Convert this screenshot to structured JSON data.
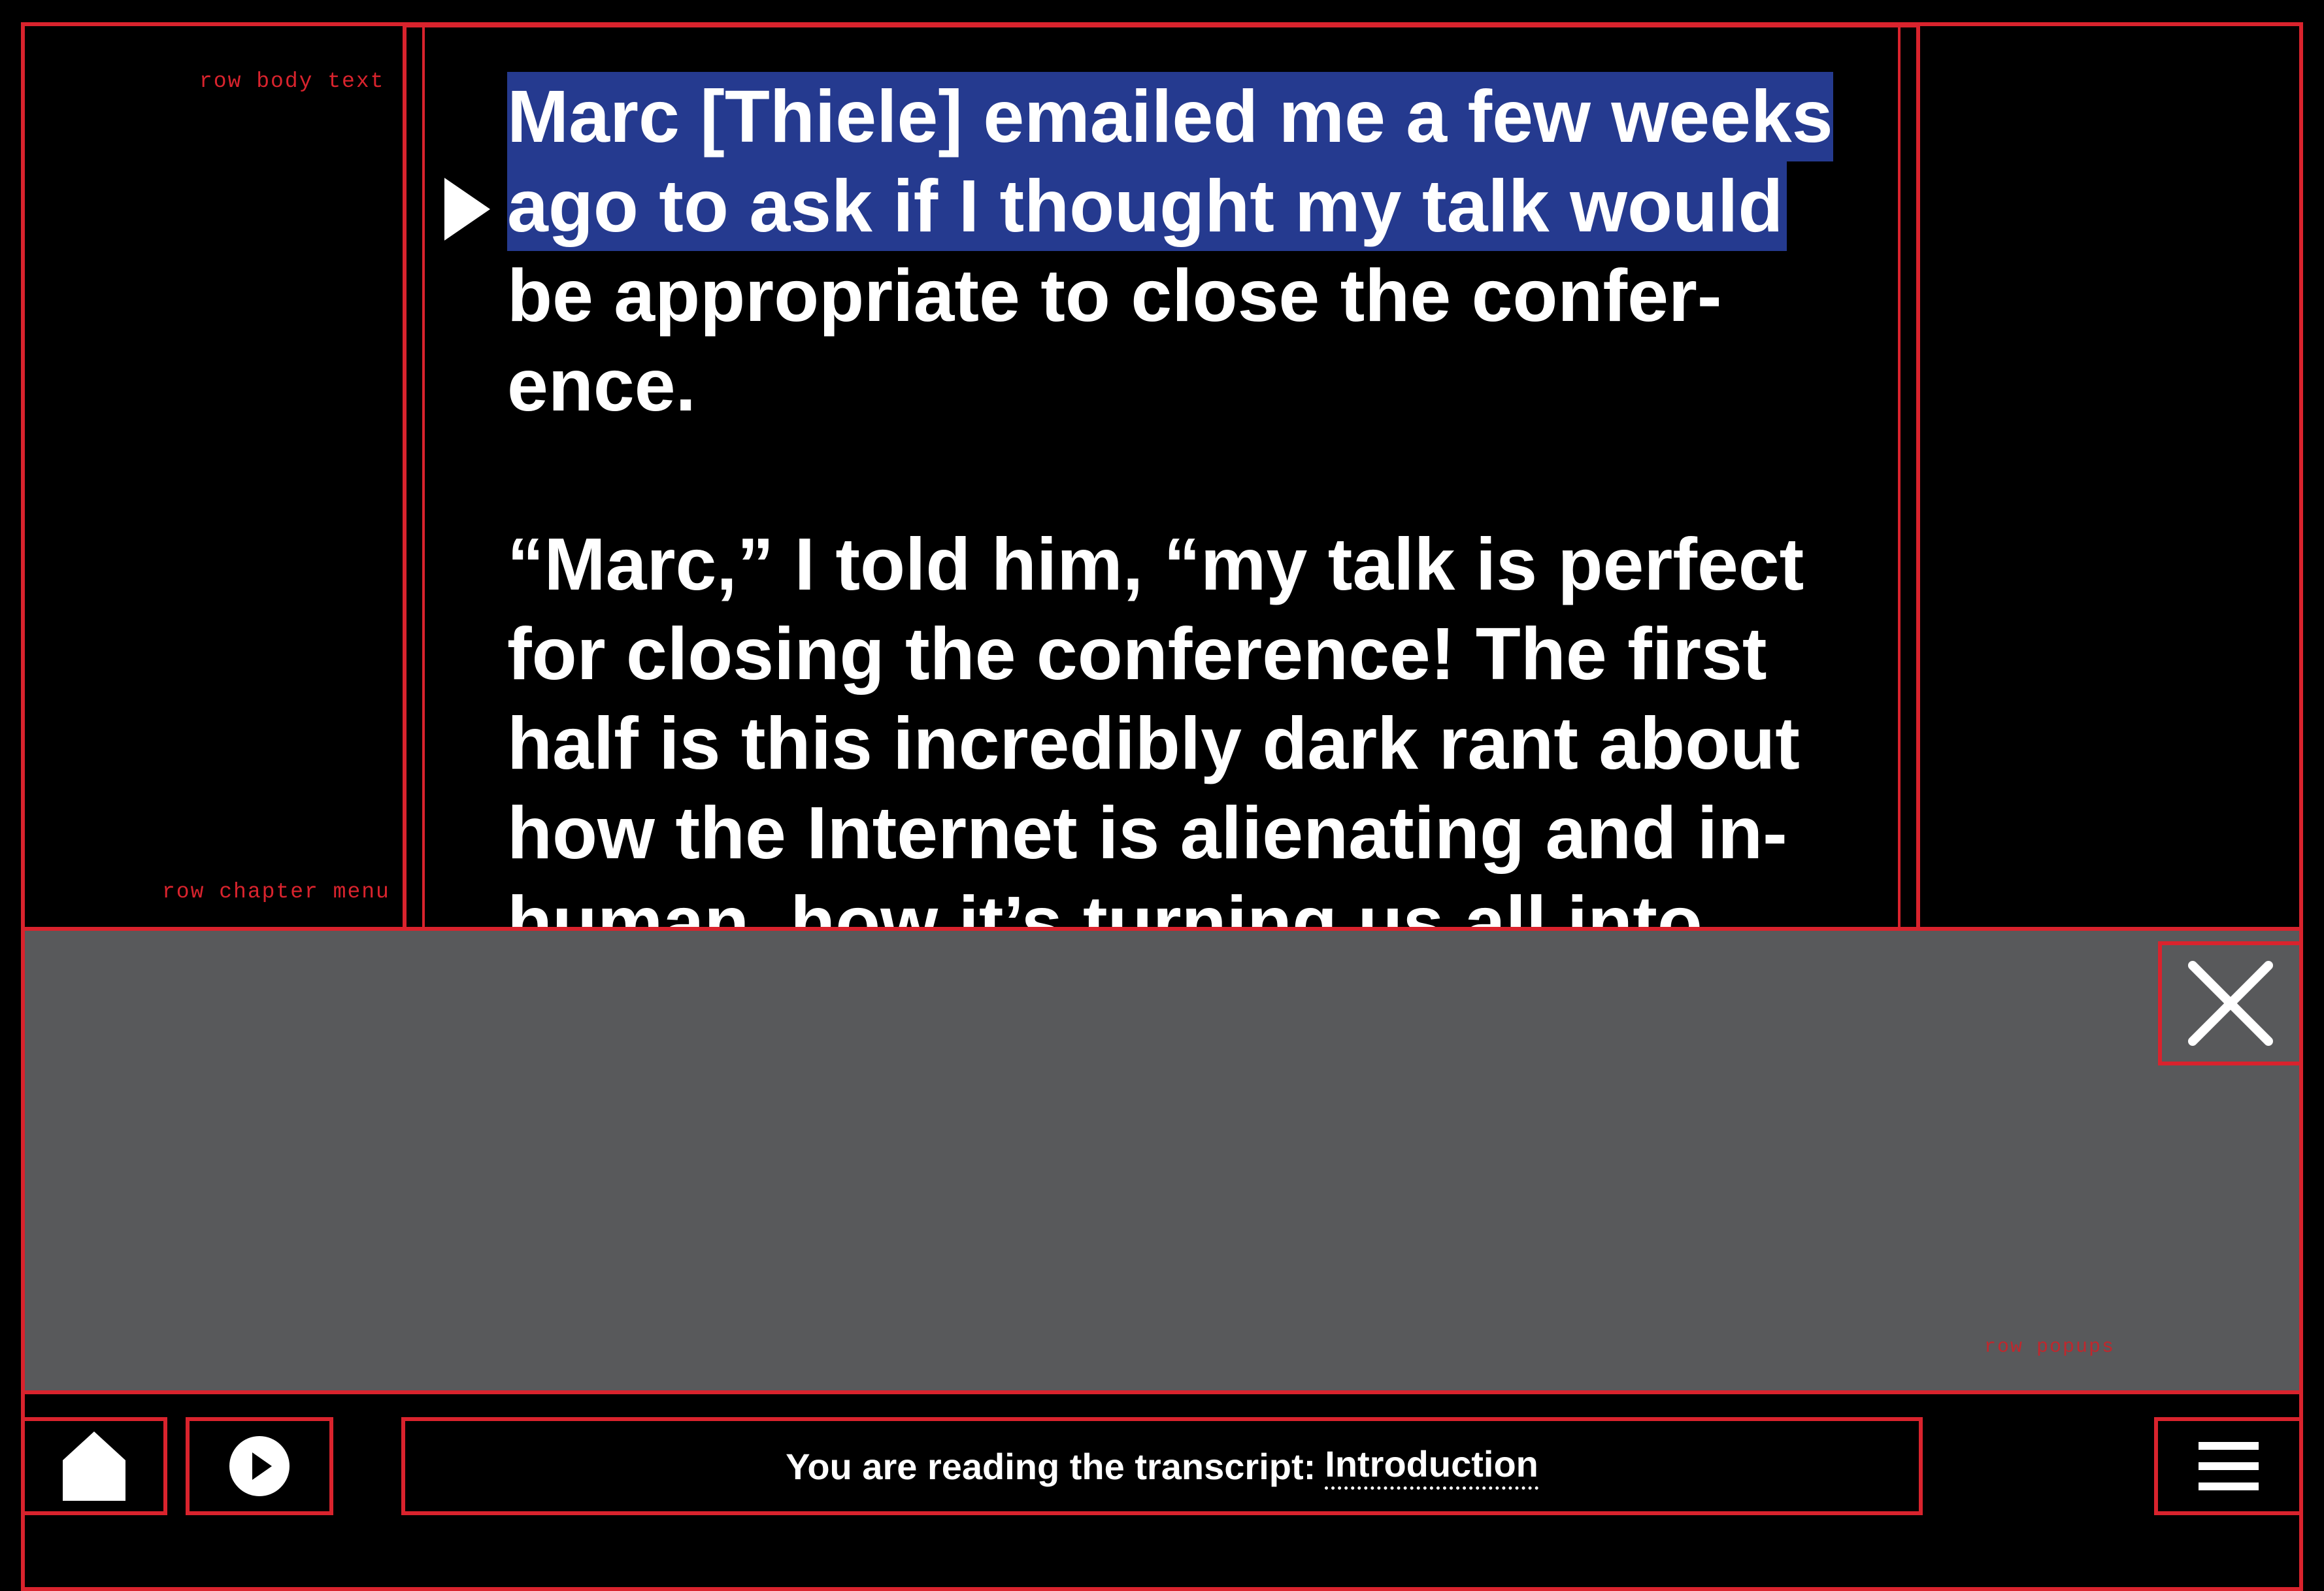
{
  "debug_labels": {
    "row_body_text": "row body text",
    "row_chapter_menu": "row chapter menu",
    "row_popups": "row popups"
  },
  "transcript": {
    "highlighted": "Marc [Thiele] emailed me a few weeks ago to ask if I thought my talk would",
    "p1_rest": "be appropriate to close the confer-ence.",
    "p2": "“Marc,” I told him, “my talk is perfect for closing the conference! The first half is this incredibly dark rant about how the Internet is alienating and in-human, how it’s turning us all into"
  },
  "status": {
    "prefix": "You are reading the transcript:",
    "link": "Introduction"
  },
  "icons": {
    "home": "home-icon",
    "play": "play-icon",
    "menu": "hamburger-menu-icon",
    "close": "close-icon",
    "current": "current-paragraph-arrow-icon"
  },
  "colors": {
    "accent": "#d9232d",
    "highlight": "#253a8f",
    "popup": "#58595b",
    "background": "#000000",
    "text": "#ffffff"
  }
}
